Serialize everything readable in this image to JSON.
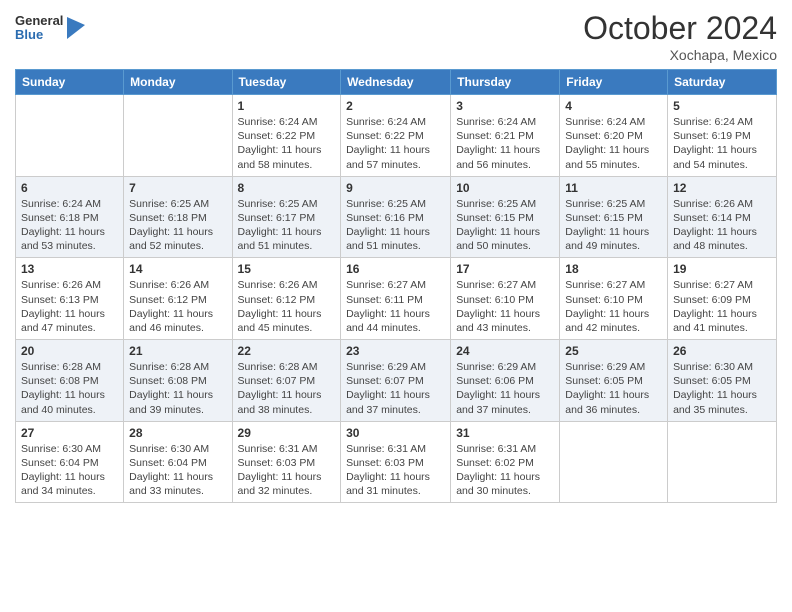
{
  "header": {
    "logo_general": "General",
    "logo_blue": "Blue",
    "month_title": "October 2024",
    "location": "Xochapa, Mexico"
  },
  "weekdays": [
    "Sunday",
    "Monday",
    "Tuesday",
    "Wednesday",
    "Thursday",
    "Friday",
    "Saturday"
  ],
  "weeks": [
    [
      {
        "day": "",
        "info": ""
      },
      {
        "day": "",
        "info": ""
      },
      {
        "day": "1",
        "info": "Sunrise: 6:24 AM\nSunset: 6:22 PM\nDaylight: 11 hours and 58 minutes."
      },
      {
        "day": "2",
        "info": "Sunrise: 6:24 AM\nSunset: 6:22 PM\nDaylight: 11 hours and 57 minutes."
      },
      {
        "day": "3",
        "info": "Sunrise: 6:24 AM\nSunset: 6:21 PM\nDaylight: 11 hours and 56 minutes."
      },
      {
        "day": "4",
        "info": "Sunrise: 6:24 AM\nSunset: 6:20 PM\nDaylight: 11 hours and 55 minutes."
      },
      {
        "day": "5",
        "info": "Sunrise: 6:24 AM\nSunset: 6:19 PM\nDaylight: 11 hours and 54 minutes."
      }
    ],
    [
      {
        "day": "6",
        "info": "Sunrise: 6:24 AM\nSunset: 6:18 PM\nDaylight: 11 hours and 53 minutes."
      },
      {
        "day": "7",
        "info": "Sunrise: 6:25 AM\nSunset: 6:18 PM\nDaylight: 11 hours and 52 minutes."
      },
      {
        "day": "8",
        "info": "Sunrise: 6:25 AM\nSunset: 6:17 PM\nDaylight: 11 hours and 51 minutes."
      },
      {
        "day": "9",
        "info": "Sunrise: 6:25 AM\nSunset: 6:16 PM\nDaylight: 11 hours and 51 minutes."
      },
      {
        "day": "10",
        "info": "Sunrise: 6:25 AM\nSunset: 6:15 PM\nDaylight: 11 hours and 50 minutes."
      },
      {
        "day": "11",
        "info": "Sunrise: 6:25 AM\nSunset: 6:15 PM\nDaylight: 11 hours and 49 minutes."
      },
      {
        "day": "12",
        "info": "Sunrise: 6:26 AM\nSunset: 6:14 PM\nDaylight: 11 hours and 48 minutes."
      }
    ],
    [
      {
        "day": "13",
        "info": "Sunrise: 6:26 AM\nSunset: 6:13 PM\nDaylight: 11 hours and 47 minutes."
      },
      {
        "day": "14",
        "info": "Sunrise: 6:26 AM\nSunset: 6:12 PM\nDaylight: 11 hours and 46 minutes."
      },
      {
        "day": "15",
        "info": "Sunrise: 6:26 AM\nSunset: 6:12 PM\nDaylight: 11 hours and 45 minutes."
      },
      {
        "day": "16",
        "info": "Sunrise: 6:27 AM\nSunset: 6:11 PM\nDaylight: 11 hours and 44 minutes."
      },
      {
        "day": "17",
        "info": "Sunrise: 6:27 AM\nSunset: 6:10 PM\nDaylight: 11 hours and 43 minutes."
      },
      {
        "day": "18",
        "info": "Sunrise: 6:27 AM\nSunset: 6:10 PM\nDaylight: 11 hours and 42 minutes."
      },
      {
        "day": "19",
        "info": "Sunrise: 6:27 AM\nSunset: 6:09 PM\nDaylight: 11 hours and 41 minutes."
      }
    ],
    [
      {
        "day": "20",
        "info": "Sunrise: 6:28 AM\nSunset: 6:08 PM\nDaylight: 11 hours and 40 minutes."
      },
      {
        "day": "21",
        "info": "Sunrise: 6:28 AM\nSunset: 6:08 PM\nDaylight: 11 hours and 39 minutes."
      },
      {
        "day": "22",
        "info": "Sunrise: 6:28 AM\nSunset: 6:07 PM\nDaylight: 11 hours and 38 minutes."
      },
      {
        "day": "23",
        "info": "Sunrise: 6:29 AM\nSunset: 6:07 PM\nDaylight: 11 hours and 37 minutes."
      },
      {
        "day": "24",
        "info": "Sunrise: 6:29 AM\nSunset: 6:06 PM\nDaylight: 11 hours and 37 minutes."
      },
      {
        "day": "25",
        "info": "Sunrise: 6:29 AM\nSunset: 6:05 PM\nDaylight: 11 hours and 36 minutes."
      },
      {
        "day": "26",
        "info": "Sunrise: 6:30 AM\nSunset: 6:05 PM\nDaylight: 11 hours and 35 minutes."
      }
    ],
    [
      {
        "day": "27",
        "info": "Sunrise: 6:30 AM\nSunset: 6:04 PM\nDaylight: 11 hours and 34 minutes."
      },
      {
        "day": "28",
        "info": "Sunrise: 6:30 AM\nSunset: 6:04 PM\nDaylight: 11 hours and 33 minutes."
      },
      {
        "day": "29",
        "info": "Sunrise: 6:31 AM\nSunset: 6:03 PM\nDaylight: 11 hours and 32 minutes."
      },
      {
        "day": "30",
        "info": "Sunrise: 6:31 AM\nSunset: 6:03 PM\nDaylight: 11 hours and 31 minutes."
      },
      {
        "day": "31",
        "info": "Sunrise: 6:31 AM\nSunset: 6:02 PM\nDaylight: 11 hours and 30 minutes."
      },
      {
        "day": "",
        "info": ""
      },
      {
        "day": "",
        "info": ""
      }
    ]
  ]
}
